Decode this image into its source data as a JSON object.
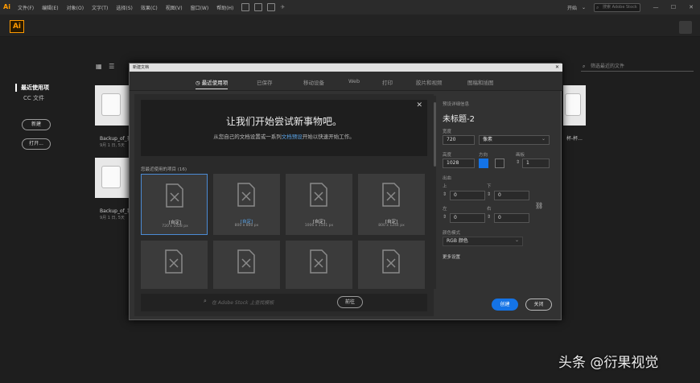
{
  "menubar": {
    "app_icon": "Ai",
    "items": [
      "文件(F)",
      "编辑(E)",
      "对象(O)",
      "文字(T)",
      "选择(S)",
      "效果(C)",
      "视图(V)",
      "窗口(W)",
      "帮助(H)"
    ],
    "workspace": "开始",
    "search_placeholder": "搜索 Adobe Stock",
    "min": "—",
    "max": "☐",
    "close": "✕"
  },
  "app_logo": "Ai",
  "sidebar": {
    "recent": "最近使用项",
    "cc_files": "CC 文件",
    "new_button": "新建",
    "open_button": "打开..."
  },
  "home": {
    "search_placeholder": "筛选最近的文件",
    "files": [
      {
        "name": "Backup_of_我",
        "date": "9月 1 日, 5天"
      },
      {
        "name": "Backup_of_我",
        "date": "9月 1 日, 5天"
      }
    ],
    "partial_label": "杯-杯..."
  },
  "dialog": {
    "title": "新建文档",
    "close": "✕",
    "tabs": [
      "最近使用项",
      "已保存",
      "移动设备",
      "Web",
      "打印",
      "胶片和视频",
      "图稿和插图"
    ],
    "hero": {
      "close": "✕",
      "heading": "让我们开始尝试新事物吧。",
      "sub_before": "从您自己的文档设置或一系列",
      "sub_link": "文档预设",
      "sub_after": "开始以快速开始工作。"
    },
    "recent_header": "您最近使用的项目 (16)",
    "cards": [
      {
        "name": "[自定]",
        "size": "720 x 1028 px"
      },
      {
        "name": "[自定]",
        "size": "800 x 800 px"
      },
      {
        "name": "[自定]",
        "size": "1006 x 1101 px"
      },
      {
        "name": "[自定]",
        "size": "800 x 1244 px"
      }
    ],
    "stock_placeholder": "在 Adobe Stock 上查找模板",
    "stock_button": "前往",
    "details": {
      "section_label": "预设详细信息",
      "doc_name": "未标题-2",
      "width_label": "宽度",
      "width": "720",
      "unit": "像素",
      "height_label": "高度",
      "height": "1028",
      "orientation_label": "方向",
      "artboards_label": "画板",
      "artboards": "1",
      "bleed_label": "出血",
      "top_label": "上",
      "top": "0",
      "bottom_label": "下",
      "bottom": "0",
      "left_label": "左",
      "left": "0",
      "right_label": "右",
      "right": "0",
      "color_mode_label": "颜色模式",
      "color_mode": "RGB 颜色",
      "more_settings": "更多设置"
    },
    "create_button": "创建",
    "close_button": "关闭"
  },
  "watermark": "头条 @衍果视觉"
}
